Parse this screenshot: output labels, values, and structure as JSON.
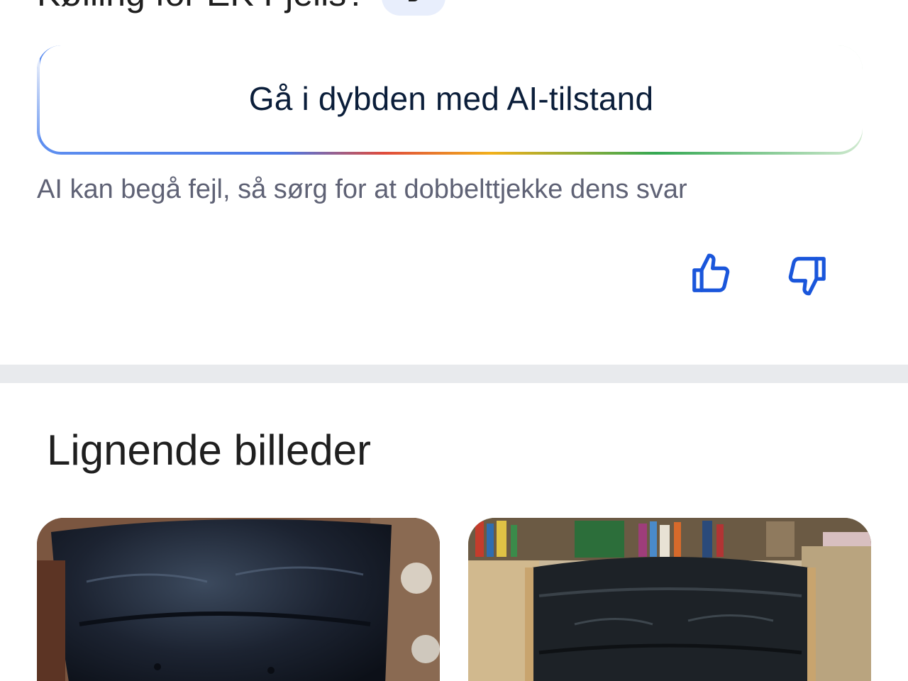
{
  "header": {
    "partial_title": "Kølling for EK Fjells?"
  },
  "ai_mode": {
    "button_label": "Gå i dybden med AI-tilstand",
    "disclaimer": "AI kan begå fejl, så sørg for at dobbelttjekke dens svar"
  },
  "feedback": {
    "thumbs_up_icon": "thumbs-up-icon",
    "thumbs_down_icon": "thumbs-down-icon",
    "color": "#1a56db"
  },
  "similar_images": {
    "title": "Lignende billeder",
    "items": [
      {
        "icon": "leather-chair-image"
      },
      {
        "icon": "leather-chair-bookshelf-image"
      }
    ]
  }
}
